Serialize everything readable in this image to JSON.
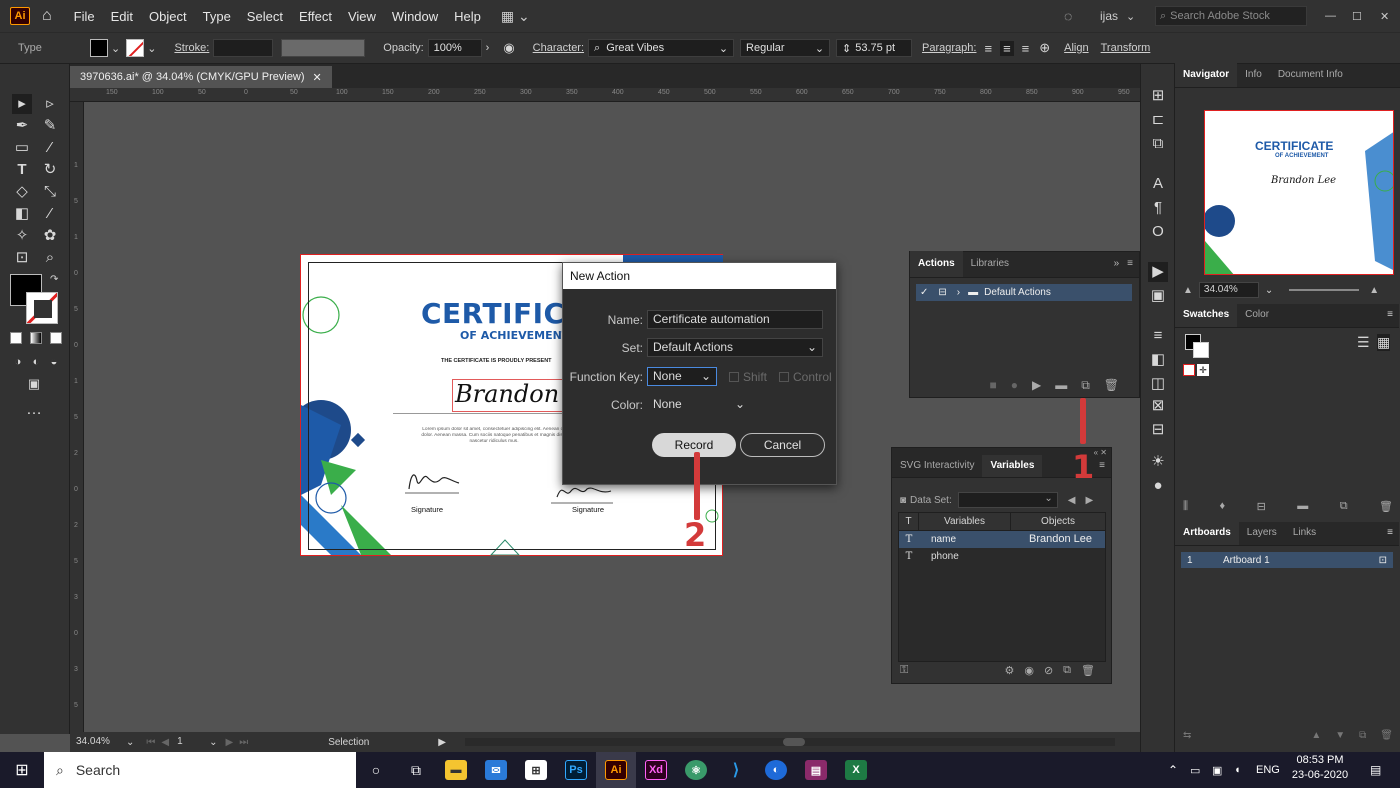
{
  "app": {
    "logo": "Ai"
  },
  "menu": [
    "File",
    "Edit",
    "Object",
    "Type",
    "Select",
    "Effect",
    "View",
    "Window",
    "Help"
  ],
  "header": {
    "user": "ijas",
    "search_placeholder": "Search Adobe Stock"
  },
  "control_bar": {
    "selection_type": "Type",
    "stroke_label": "Stroke:",
    "opacity_label": "Opacity:",
    "opacity_value": "100%",
    "character_label": "Character:",
    "font_family": "Great Vibes",
    "font_style": "Regular",
    "font_size": "53.75 pt",
    "paragraph_label": "Paragraph:",
    "align_label": "Align",
    "transform_label": "Transform"
  },
  "document_tab": {
    "title": "3970636.ai* @ 34.04% (CMYK/GPU Preview)"
  },
  "ruler_top": [
    "150",
    "100",
    "50",
    "0",
    "50",
    "100",
    "150",
    "200",
    "250",
    "300",
    "350",
    "400",
    "450",
    "500",
    "550",
    "600",
    "650",
    "700",
    "750",
    "800",
    "850",
    "900",
    "950",
    "1000"
  ],
  "ruler_left": [
    "1",
    "5",
    "1",
    "0",
    "5",
    "0",
    "1",
    "5",
    "2",
    "0",
    "2",
    "5",
    "3",
    "0",
    "3",
    "5"
  ],
  "certificate": {
    "title": "CERTIFICA",
    "subtitle": "OF ACHIEVEMENT",
    "presented": "THE CERTIFICATE IS PROUDLY PRESENT",
    "recipient": "Brandon Le",
    "body": "Lorem ipsum dolor sit amet, consectetuer adipiscing elit. Aenean co dolor. Aenean massa. Cum sociis natoque penatibus et magnis dis p nascetur ridiculus mus.",
    "sig1": "Signature",
    "sig2": "Signature"
  },
  "dialog": {
    "title": "New Action",
    "name_label": "Name:",
    "name_value": "Certificate automation",
    "set_label": "Set:",
    "set_value": "Default Actions",
    "fkey_label": "Function Key:",
    "fkey_value": "None",
    "shift_label": "Shift",
    "control_label": "Control",
    "color_label": "Color:",
    "color_value": "None",
    "record_label": "Record",
    "cancel_label": "Cancel"
  },
  "actions_panel": {
    "tabs": [
      "Actions",
      "Libraries"
    ],
    "item": "Default Actions"
  },
  "variables_panel": {
    "tabs": [
      "SVG Interactivity",
      "Variables"
    ],
    "dataset_label": "Data Set:",
    "columns": [
      "T",
      "Variables",
      "Objects"
    ],
    "rows": [
      {
        "type": "T",
        "name": "name",
        "object": "Brandon Lee"
      },
      {
        "type": "T",
        "name": "phone",
        "object": ""
      }
    ]
  },
  "annotations": {
    "one": "1",
    "two": "2"
  },
  "navigator": {
    "tabs": [
      "Navigator",
      "Info",
      "Document Info"
    ],
    "zoom": "34.04%",
    "thumb_title": "CERTIFICATE",
    "thumb_sub": "OF ACHIEVEMENT",
    "thumb_name": "Brandon Lee"
  },
  "swatches": {
    "tabs": [
      "Swatches",
      "Color"
    ]
  },
  "artboards": {
    "tabs": [
      "Artboards",
      "Layers",
      "Links"
    ],
    "row_num": "1",
    "row_name": "Artboard 1"
  },
  "statusbar": {
    "zoom": "34.04%",
    "artboard": "1",
    "mode": "Selection"
  },
  "taskbar": {
    "search": "Search",
    "lang": "ENG",
    "time": "08:53 PM",
    "date": "23-06-2020"
  },
  "colors": {
    "accent": "#d33a3a",
    "cert_blue": "#1e5aa8",
    "cert_green": "#3aae4a"
  }
}
